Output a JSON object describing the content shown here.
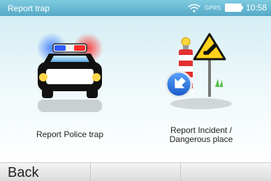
{
  "status_bar": {
    "title": "Report trap",
    "network_text": "GPRS",
    "time": "10:58"
  },
  "tiles": [
    {
      "label": "Report Police trap",
      "icon": "police-car-icon"
    },
    {
      "label_line1": "Report Incident /",
      "label_line2": "Dangerous place",
      "icon": "hazard-sign-icon"
    }
  ],
  "bottom_bar": {
    "back_label": "Back"
  }
}
